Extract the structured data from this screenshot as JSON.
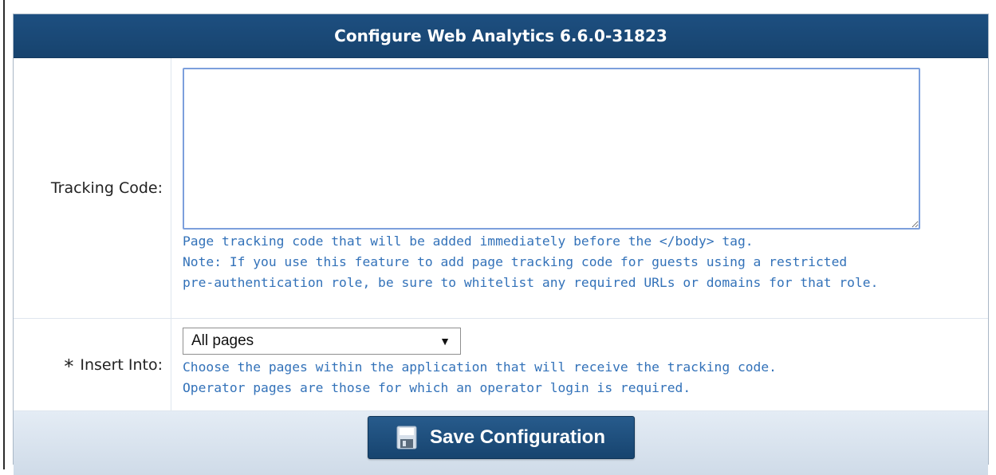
{
  "panel": {
    "title": "Configure Web Analytics 6.6.0-31823"
  },
  "tracking_code": {
    "label": "Tracking Code:",
    "value": "",
    "help_lines": [
      "Page tracking code that will be added immediately before the </body> tag.",
      "Note: If you use this feature to add page tracking code for guests using a restricted",
      "pre-authentication role, be sure to whitelist any required URLs or domains for that role."
    ]
  },
  "insert_into": {
    "required_marker": "*",
    "label": "Insert Into:",
    "selected": "All pages",
    "help_lines": [
      "Choose the pages within the application that will receive the tracking code.",
      "Operator pages are those for which an operator login is required."
    ]
  },
  "footer": {
    "save_label": "Save Configuration",
    "save_icon": "floppy-disk-icon"
  },
  "colors": {
    "header": "#1d4f80",
    "help_text": "#3372b9",
    "footer_bg": "#dbe5f0"
  }
}
